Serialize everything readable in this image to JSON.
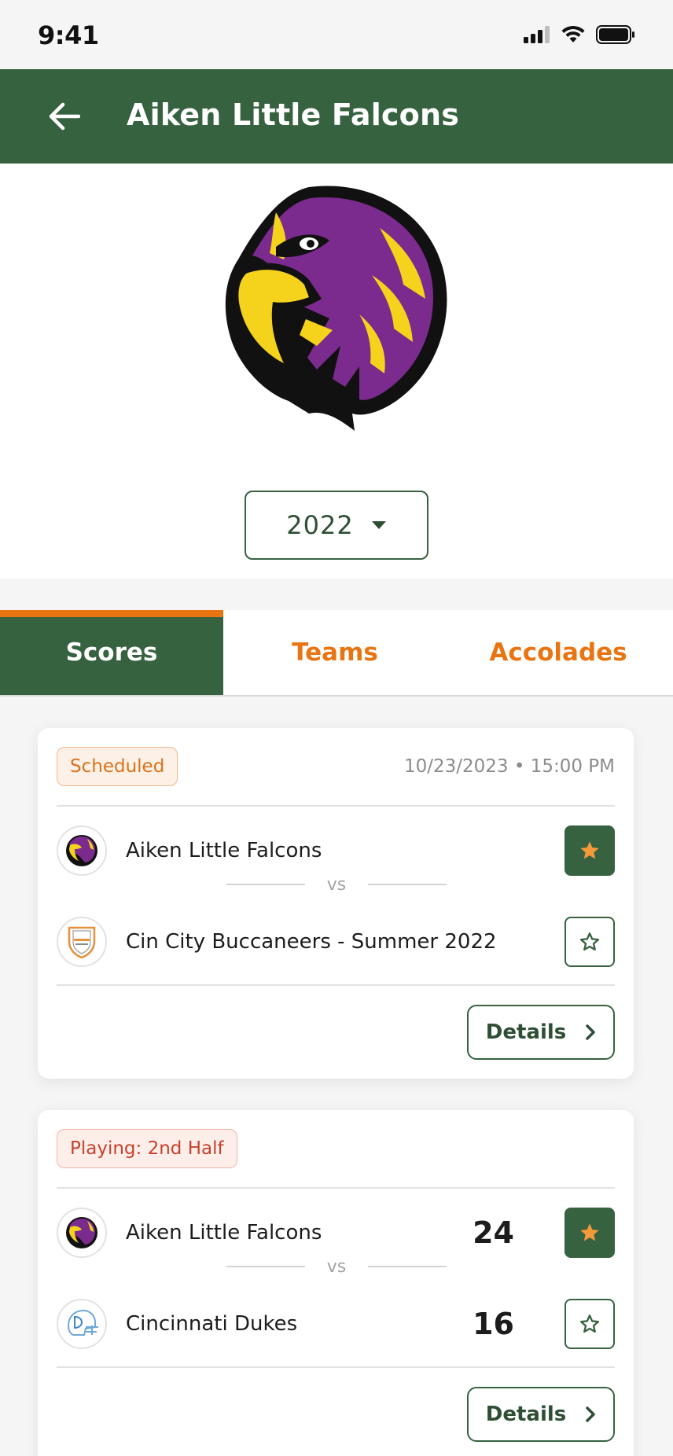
{
  "status_bar": {
    "time": "9:41"
  },
  "header": {
    "title": "Aiken Little Falcons"
  },
  "year_select": {
    "value": "2022"
  },
  "tabs": [
    {
      "label": "Scores",
      "active": true
    },
    {
      "label": "Teams",
      "active": false
    },
    {
      "label": "Accolades",
      "active": false
    }
  ],
  "games": [
    {
      "status": "Scheduled",
      "datetime": "10/23/2023 • 15:00 PM",
      "vs": "vs",
      "home": {
        "name": "Aiken Little Falcons",
        "favorite": true
      },
      "away": {
        "name": "Cin City Buccaneers - Summer 2022",
        "favorite": false
      },
      "details_label": "Details"
    },
    {
      "status": "Playing: 2nd Half",
      "vs": "vs",
      "home": {
        "name": "Aiken Little Falcons",
        "score": "24",
        "favorite": true
      },
      "away": {
        "name": "Cincinnati Dukes",
        "score": "16",
        "favorite": false
      },
      "details_label": "Details"
    }
  ],
  "colors": {
    "primary_green": "#376240",
    "accent_orange": "#e87511",
    "falcon_purple": "#7b2a8e",
    "falcon_yellow": "#f5d31c"
  }
}
